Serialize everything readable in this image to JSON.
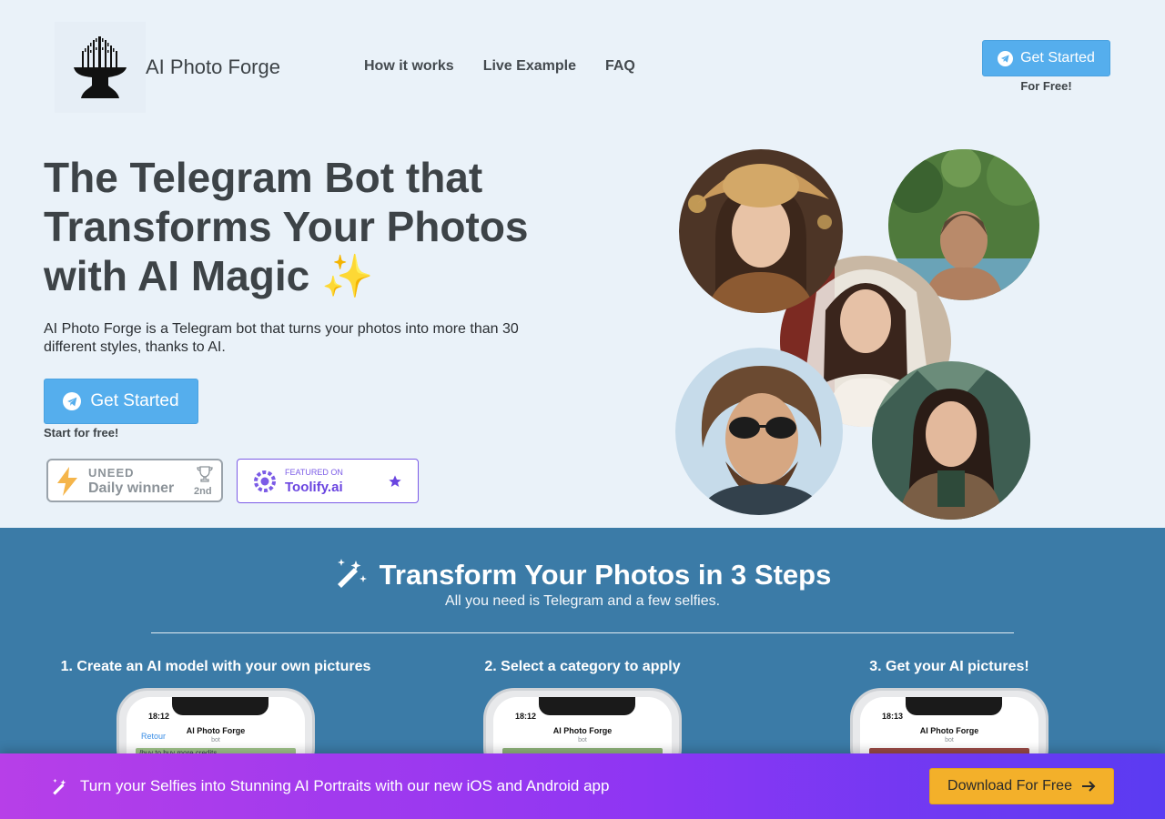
{
  "header": {
    "brand": "AI Photo Forge",
    "nav": [
      {
        "label": "How it works"
      },
      {
        "label": "Live Example"
      },
      {
        "label": "FAQ"
      }
    ],
    "cta_label": "Get Started",
    "cta_sub": "For Free!"
  },
  "hero": {
    "title_line1": "The Telegram Bot that",
    "title_line2": "Transforms Your Photos",
    "title_line3": "with AI Magic",
    "sparkle": "✨",
    "description": "AI Photo Forge is a Telegram bot that turns your photos into more than 30 different styles, thanks to AI.",
    "cta_label": "Get Started",
    "cta_sub": "Start for free!"
  },
  "badges": {
    "uneed": {
      "brand": "UNEED",
      "title": "Daily winner",
      "rank": "2nd"
    },
    "toolify": {
      "small": "FEATURED ON",
      "big": "Toolify.ai"
    }
  },
  "steps": {
    "title": "Transform Your Photos in 3 Steps",
    "subtitle": "All you need is Telegram and a few selfies.",
    "items": [
      {
        "label": "1. Create an AI model with your own pictures",
        "time": "18:12",
        "chat_name": "AI Photo Forge",
        "chat_sub": "bot",
        "back": "Retour",
        "line": "/buy to buy more credits"
      },
      {
        "label": "2. Select a category to apply",
        "time": "18:12",
        "chat_name": "AI Photo Forge",
        "chat_sub": "bot",
        "back": "",
        "line": ""
      },
      {
        "label": "3. Get your AI pictures!",
        "time": "18:13",
        "chat_name": "AI Photo Forge",
        "chat_sub": "bot",
        "back": "",
        "line": ""
      }
    ]
  },
  "banner": {
    "text": "Turn your Selfies into Stunning AI Portraits with our new iOS and Android app",
    "cta_label": "Download For Free"
  },
  "colors": {
    "accent": "#55aeed",
    "steps_bg": "#3b7ba7",
    "banner_start": "#b73fe8",
    "banner_end": "#5a3bf2",
    "banner_btn": "#f3b02a"
  }
}
